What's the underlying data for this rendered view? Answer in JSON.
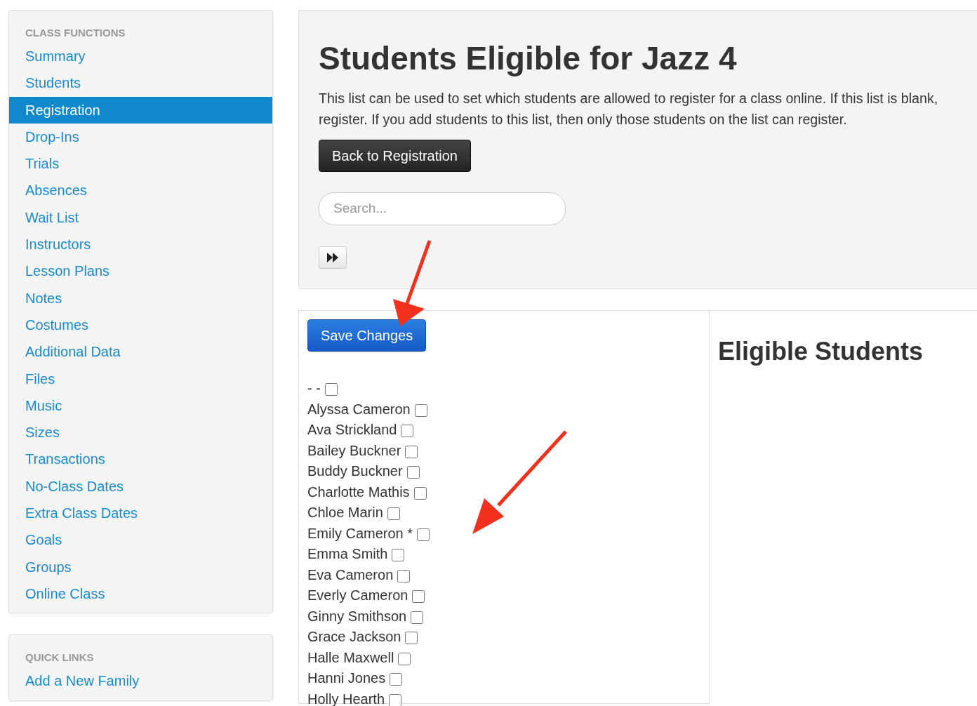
{
  "sidebar": [
    {
      "heading": "CLASS FUNCTIONS",
      "items": [
        {
          "label": "Summary",
          "selected": false
        },
        {
          "label": "Students",
          "selected": false
        },
        {
          "label": "Registration",
          "selected": true
        },
        {
          "label": "Drop-Ins",
          "selected": false
        },
        {
          "label": "Trials",
          "selected": false
        },
        {
          "label": "Absences",
          "selected": false
        },
        {
          "label": "Wait List",
          "selected": false
        },
        {
          "label": "Instructors",
          "selected": false
        },
        {
          "label": "Lesson Plans",
          "selected": false
        },
        {
          "label": "Notes",
          "selected": false
        },
        {
          "label": "Costumes",
          "selected": false
        },
        {
          "label": "Additional Data",
          "selected": false
        },
        {
          "label": "Files",
          "selected": false
        },
        {
          "label": "Music",
          "selected": false
        },
        {
          "label": "Sizes",
          "selected": false
        },
        {
          "label": "Transactions",
          "selected": false
        },
        {
          "label": "No-Class Dates",
          "selected": false
        },
        {
          "label": "Extra Class Dates",
          "selected": false
        },
        {
          "label": "Goals",
          "selected": false
        },
        {
          "label": "Groups",
          "selected": false
        },
        {
          "label": "Online Class",
          "selected": false
        }
      ]
    },
    {
      "heading": "QUICK LINKS",
      "items": [
        {
          "label": "Add a New Family",
          "selected": false
        }
      ]
    }
  ],
  "header": {
    "title": "Students Eligible for Jazz 4",
    "description_lines": [
      "This list can be used to set which students are allowed to register for a class online. If this list is blank,",
      "register. If you add students to this list, then only those students on the list can register."
    ],
    "back_button": "Back to Registration",
    "search": {
      "placeholder": "Search..."
    }
  },
  "students_panel": {
    "save_button": "Save Changes",
    "students": [
      {
        "name": "- -",
        "checked": false
      },
      {
        "name": "Alyssa Cameron",
        "checked": false
      },
      {
        "name": "Ava Strickland",
        "checked": false
      },
      {
        "name": "Bailey Buckner",
        "checked": false
      },
      {
        "name": "Buddy Buckner",
        "checked": false
      },
      {
        "name": "Charlotte Mathis",
        "checked": false
      },
      {
        "name": "Chloe Marin",
        "checked": false
      },
      {
        "name": "Emily Cameron *",
        "checked": false
      },
      {
        "name": "Emma Smith",
        "checked": false
      },
      {
        "name": "Eva Cameron",
        "checked": false
      },
      {
        "name": "Everly Cameron",
        "checked": false
      },
      {
        "name": "Ginny Smithson",
        "checked": false
      },
      {
        "name": "Grace Jackson",
        "checked": false
      },
      {
        "name": "Halle Maxwell",
        "checked": false
      },
      {
        "name": "Hanni Jones",
        "checked": false
      },
      {
        "name": "Holly Hearth",
        "checked": false
      }
    ]
  },
  "eligible_panel": {
    "title": "Eligible Students"
  }
}
